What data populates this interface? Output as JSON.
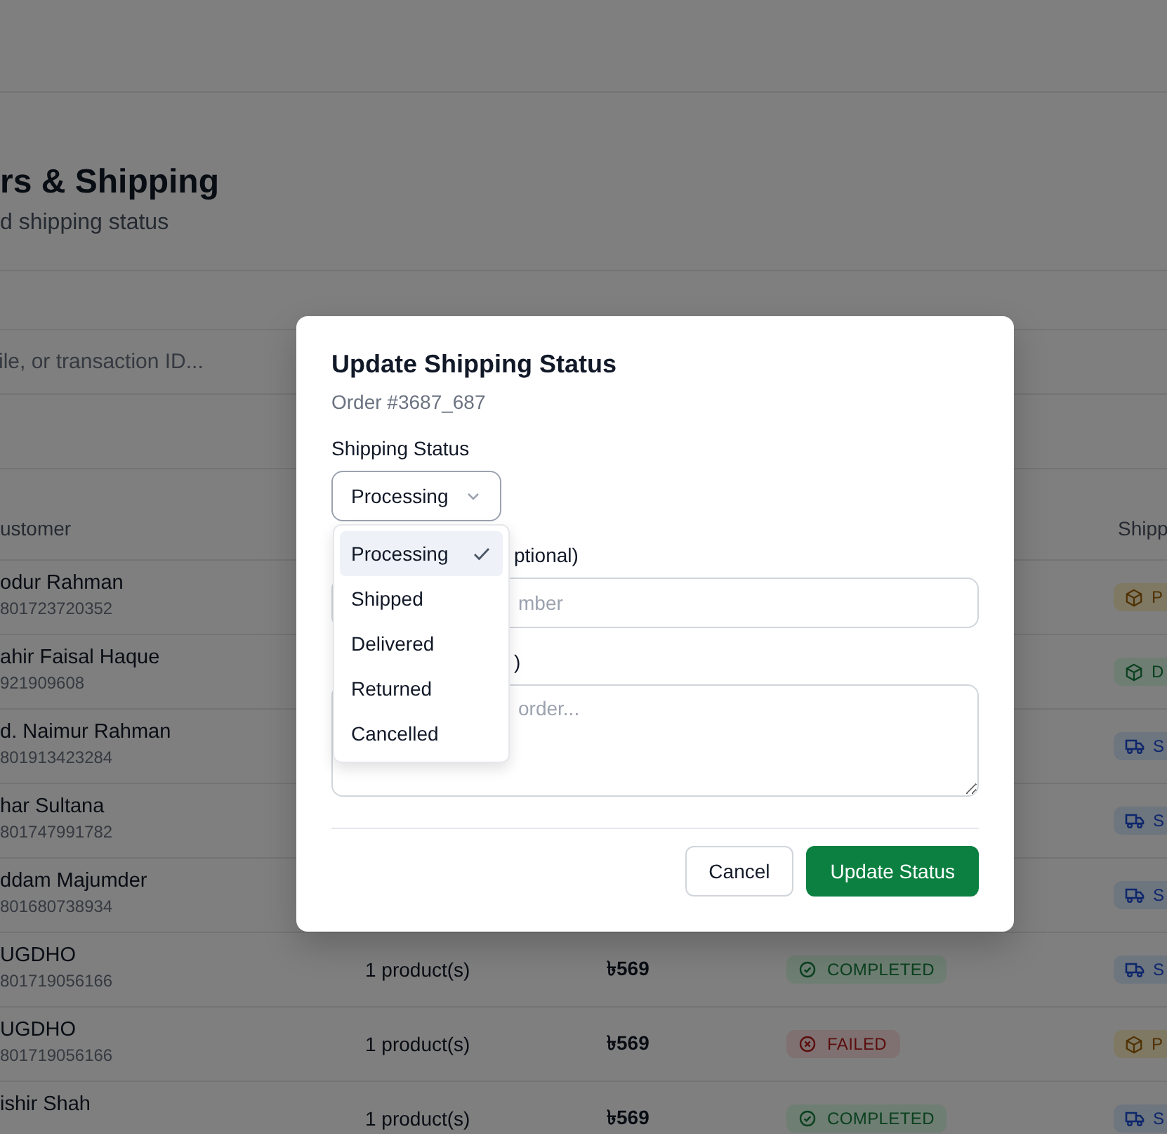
{
  "page": {
    "title": "rs & Shipping",
    "subtitle": "d shipping status",
    "search": {
      "placeholder": "ile, or transaction ID..."
    }
  },
  "table": {
    "columns": [
      "ustomer",
      "Shipp"
    ],
    "rows": [
      {
        "name": "odur Rahman",
        "phone": "801723720352",
        "shipping": {
          "label": "P",
          "kind": "processing"
        }
      },
      {
        "name": "ahir Faisal Haque",
        "phone": "921909608",
        "shipping": {
          "label": "D",
          "kind": "delivered"
        }
      },
      {
        "name": "d. Naimur Rahman",
        "phone": "801913423284",
        "shipping": {
          "label": "S",
          "kind": "shipped"
        }
      },
      {
        "name": "har Sultana",
        "phone": "801747991782",
        "shipping": {
          "label": "S",
          "kind": "shipped"
        }
      },
      {
        "name": "ddam Majumder",
        "phone": "801680738934",
        "shipping": {
          "label": "S",
          "kind": "shipped"
        }
      },
      {
        "name": "UGDHO",
        "phone": "801719056166",
        "products": "1 product(s)",
        "amount": "৳569",
        "payment": {
          "label": "COMPLETED",
          "kind": "completed"
        },
        "shipping": {
          "label": "S",
          "kind": "shipped"
        }
      },
      {
        "name": "UGDHO",
        "phone": "801719056166",
        "products": "1 product(s)",
        "amount": "৳569",
        "payment": {
          "label": "FAILED",
          "kind": "failed"
        },
        "shipping": {
          "label": "P",
          "kind": "processing"
        }
      },
      {
        "name": "ishir Shah",
        "products": "1 product(s)",
        "amount": "৳569",
        "payment": {
          "label": "COMPLETED",
          "kind": "completed"
        },
        "shipping": {
          "label": "S",
          "kind": "shipped"
        }
      }
    ]
  },
  "dialog": {
    "title": "Update Shipping Status",
    "subtitle": "Order #3687_687",
    "status_label": "Shipping Status",
    "select": {
      "value": "Processing",
      "expanded": true
    },
    "options": [
      {
        "label": "Processing",
        "selected": true
      },
      {
        "label": "Shipped",
        "selected": false
      },
      {
        "label": "Delivered",
        "selected": false
      },
      {
        "label": "Returned",
        "selected": false
      },
      {
        "label": "Cancelled",
        "selected": false
      }
    ],
    "tracking_label": "ptional)",
    "tracking_placeholder": "mber",
    "notes_label": ")",
    "notes_placeholder": "order...",
    "buttons": [
      {
        "label": "Cancel",
        "kind": "secondary"
      },
      {
        "label": "Update Status",
        "kind": "primary"
      }
    ]
  }
}
